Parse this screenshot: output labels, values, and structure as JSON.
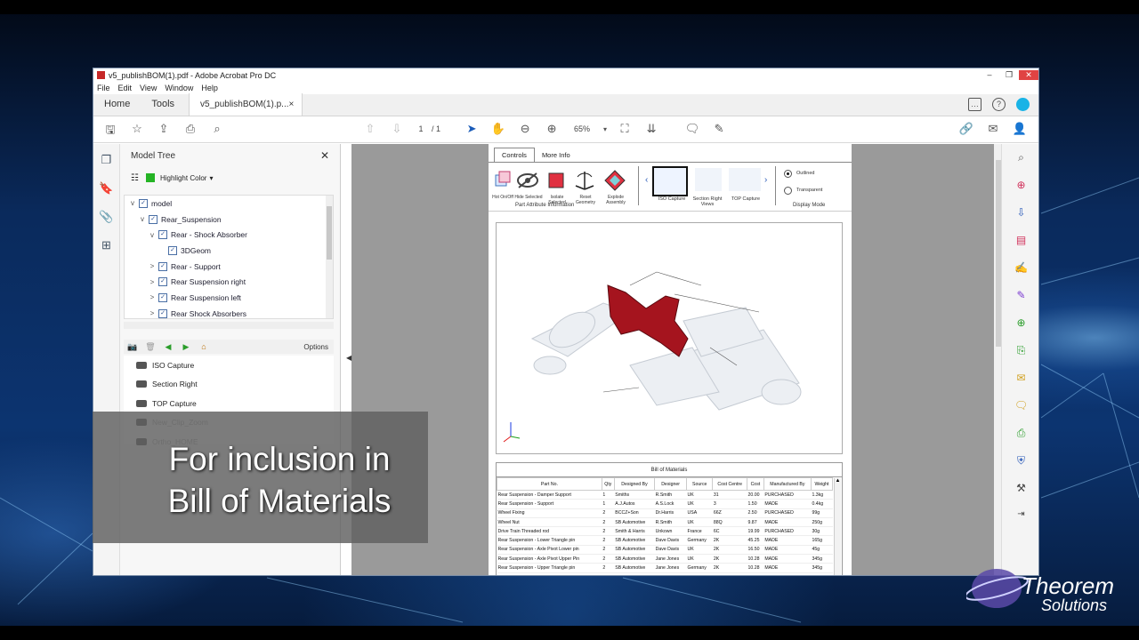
{
  "window": {
    "title": "v5_publishBOM(1).pdf - Adobe Acrobat Pro DC",
    "controls": [
      "–",
      "❐",
      "✕"
    ]
  },
  "menu": [
    "File",
    "Edit",
    "View",
    "Window",
    "Help"
  ],
  "tabs": {
    "home": "Home",
    "tools": "Tools",
    "document": "v5_publishBOM(1).p...",
    "close": "×"
  },
  "toolbar": {
    "page_current": "1",
    "page_total": "/ 1",
    "zoom": "65%"
  },
  "model_tree": {
    "title": "Model Tree",
    "highlight_label": "Highlight Color",
    "highlight_color": "#25b425",
    "items": [
      {
        "label": "model",
        "twisty": "v",
        "indent": 0
      },
      {
        "label": "Rear_Suspension",
        "twisty": "v",
        "indent": 1
      },
      {
        "label": "Rear - Shock Absorber",
        "twisty": "v",
        "indent": 2
      },
      {
        "label": "3DGeom",
        "twisty": "",
        "indent": 3
      },
      {
        "label": "Rear - Support",
        "twisty": ">",
        "indent": 2
      },
      {
        "label": "Rear Suspension right",
        "twisty": ">",
        "indent": 2
      },
      {
        "label": "Rear Suspension left",
        "twisty": ">",
        "indent": 2
      },
      {
        "label": "Rear Shock Absorbers",
        "twisty": ">",
        "indent": 2
      }
    ]
  },
  "views": {
    "options_label": "Options",
    "items": [
      "ISO Capture",
      "Section Right",
      "TOP Capture",
      "New_Clip_Zoom",
      "Ortho_HOME"
    ]
  },
  "controls_panel": {
    "tab_controls": "Controls",
    "tab_more_info": "More Info",
    "tools": [
      "Hot On/Off",
      "Hide Selected",
      "Isolate Selected",
      "Reset Geometry",
      "Explode Assembly"
    ],
    "group_label": "Part Attribute Information",
    "views": [
      "ISO Capture",
      "Section Right Views",
      "TOP Capture"
    ],
    "display_modes": [
      "Outlined",
      "Transparent"
    ],
    "display_label": "Display Mode"
  },
  "bom": {
    "title": "Bill of Materials",
    "columns": [
      "Part No.",
      "Qty",
      "Designed By",
      "Designer",
      "Source",
      "Cost Centre",
      "Cost",
      "Manufactured By",
      "Weight"
    ],
    "rows": [
      [
        "Rear Suspension - Damper Support",
        "1",
        "Smiths",
        "R.Smith",
        "UK",
        "31",
        "20.00",
        "PURCHASED",
        "1.3kg"
      ],
      [
        "Rear Suspension - Support",
        "1",
        "A.J.Autos",
        "A.S.Lock",
        "UK",
        "3",
        "1.50",
        "MADE",
        "0.4kg"
      ],
      [
        "Wheel Fixing",
        "2",
        "BCCZ+Son",
        "Dr.Harris",
        "USA",
        "66Z",
        "2.50",
        "PURCHASED",
        "99g"
      ],
      [
        "Wheel Nut",
        "2",
        "SB Automotive",
        "R.Smith",
        "UK",
        "88Q",
        "9.87",
        "MADE",
        "250g"
      ],
      [
        "Drive Train Threaded rod",
        "2",
        "Smith & Harris",
        "Unkown",
        "France",
        "6C",
        "19.99",
        "PURCHASED",
        "30g"
      ],
      [
        "Rear Suspension - Lower Triangle pin",
        "2",
        "SB Automotive",
        "Dave Davis",
        "Germany",
        "2K",
        "45.25",
        "MADE",
        "165g"
      ],
      [
        "Rear Suspension - Axle Pivot Lower pin",
        "2",
        "SB Automotive",
        "Dave Davis",
        "UK",
        "2K",
        "16.50",
        "MADE",
        "45g"
      ],
      [
        "Rear Suspension - Axle Pivot Upper Pin",
        "2",
        "SB Automotive",
        "Jane Jones",
        "UK",
        "2K",
        "10.28",
        "MADE",
        "345g"
      ],
      [
        "Rear Suspension - Upper Triangle pin",
        "2",
        "SB Automotive",
        "Jane Jones",
        "Germany",
        "2K",
        "10.28",
        "MADE",
        "345g"
      ]
    ]
  },
  "overlay": {
    "line1": "For inclusion in",
    "line2": "Bill of Materials"
  },
  "logo": {
    "line1": "Theorem",
    "line2": "Solutions"
  },
  "colors": {
    "model_part": "#a5141e",
    "acrobat_red": "#c62828",
    "accent_blue": "#19b3e6"
  }
}
